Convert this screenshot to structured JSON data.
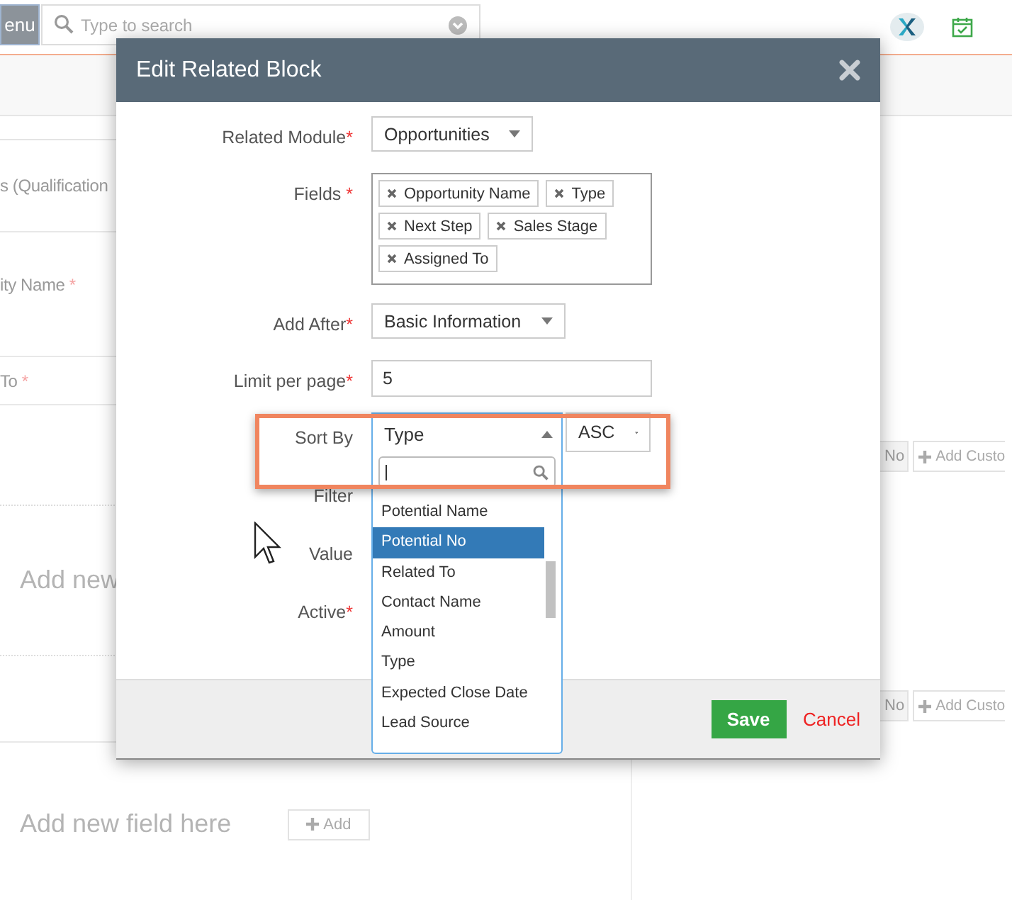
{
  "header": {
    "menu_button": "enu",
    "search": {
      "placeholder": "Type to search"
    }
  },
  "background": {
    "labels": [
      {
        "text": "s (Qualification"
      },
      {
        "text": "ity Name ",
        "mark": "*"
      },
      {
        "text": "To ",
        "mark": "*"
      }
    ],
    "big_hint": "Add new",
    "field_hint": "Add new field here",
    "add_button": "Add",
    "right_rows": [
      {
        "no": "No",
        "add_custom": "Add Custo"
      },
      {
        "no": "No",
        "add_custom": "Add Custo"
      }
    ]
  },
  "modal": {
    "title": "Edit Related Block",
    "rows": [
      {
        "kind": "select",
        "label": "Related Module",
        "mark": "*",
        "value": "Opportunities"
      },
      {
        "kind": "tags",
        "label": "Fields ",
        "mark": "*",
        "tags": [
          "Opportunity Name",
          "Type",
          "Next Step",
          "Sales Stage",
          "Assigned To"
        ]
      },
      {
        "kind": "select",
        "label": "Add After",
        "mark": "*",
        "value": "Basic Information"
      },
      {
        "kind": "input",
        "label": "Limit per page",
        "mark": "*",
        "value": "5"
      },
      {
        "kind": "sort",
        "label": "Sort By",
        "value": "Type",
        "order": "ASC"
      },
      {
        "kind": "empty",
        "label": "Filter"
      },
      {
        "kind": "empty",
        "label": "Value"
      },
      {
        "kind": "empty",
        "label": "Active",
        "mark": "*"
      }
    ],
    "dropdown": {
      "options": [
        {
          "label": "Potential Name",
          "selected": false
        },
        {
          "label": "Potential No",
          "selected": true
        },
        {
          "label": "Related To",
          "selected": false
        },
        {
          "label": "Contact Name",
          "selected": false
        },
        {
          "label": "Amount",
          "selected": false
        },
        {
          "label": "Type",
          "selected": false
        },
        {
          "label": "Expected Close Date",
          "selected": false
        },
        {
          "label": "Lead Source",
          "selected": false
        }
      ]
    },
    "save": "Save",
    "cancel": "Cancel"
  }
}
